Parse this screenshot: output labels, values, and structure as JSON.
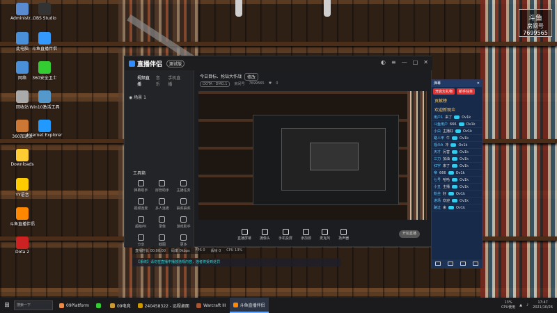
{
  "desktop": {
    "icons": [
      {
        "label": "Administr...",
        "color": "#5a8ad0"
      },
      {
        "label": "OBS Studio",
        "color": "#333"
      },
      {
        "label": "此电脑",
        "color": "#4a90d9"
      },
      {
        "label": "斗鱼直播伴侣",
        "color": "#39f"
      },
      {
        "label": "网络",
        "color": "#4a90d9"
      },
      {
        "label": "360安全卫士",
        "color": "#3c3"
      },
      {
        "label": "回收站",
        "color": "#aaa"
      },
      {
        "label": "Win10激活工具",
        "color": "#59c"
      },
      {
        "label": "360加速球",
        "color": "#c73"
      },
      {
        "label": "Internet Explorer",
        "color": "#29f"
      },
      {
        "label": "Downloads",
        "color": "#fc3"
      },
      {
        "label": "YY语音",
        "color": "#fc0"
      },
      {
        "label": "斗鱼直播伴侣",
        "color": "#f80"
      },
      {
        "label": "Dota 2",
        "color": "#c22"
      }
    ],
    "badge": {
      "brand": "斗鱼",
      "room_label": "房间号",
      "room": "7699565"
    }
  },
  "app": {
    "name": "直播伴侣",
    "tag": "测试版",
    "tabs": [
      "视频直播",
      "音乐",
      "手机直播"
    ],
    "scene": "场景 1",
    "header_title": "今日目标、抢钻大作战",
    "header_button": "修改",
    "game_tag": "DOTA · DMG.1",
    "room_label": "房间号",
    "room_no": "7699565",
    "fans": "0",
    "tools_title": "工具箱",
    "tools": [
      "弹幕助手",
      "房管助手",
      "主播任务",
      "视频连麦",
      "多人连麦",
      "抽奖抽奖",
      "超级PK",
      "录像",
      "游戏助手",
      "分享",
      "截图",
      "更多"
    ],
    "bottom": [
      "直播屏幕",
      "摄像头",
      "手机投屏",
      "添加源",
      "麦克风",
      "扬声器"
    ],
    "start_label": "开始直播",
    "status": [
      "直播时长 00:00:00",
      "码率 0kbps",
      "FPS 0",
      "丢帧 0",
      "CPU 13%"
    ],
    "notice": "【系统】请勿在直播中播放违规内容，违者将受到处罚"
  },
  "chat": {
    "title": "弹幕",
    "red_buttons": [
      "开启大礼物",
      "新手任务"
    ],
    "sections": [
      "贡献榜",
      "欢迎新观众"
    ],
    "rows": [
      {
        "user": "用户1",
        "msg": "来了",
        "gift": "Ov1k"
      },
      {
        "user": "斗鱼用户",
        "msg": "666",
        "gift": "Ov1k"
      },
      {
        "user": "小白",
        "msg": "主播好",
        "gift": "Ov1k"
      },
      {
        "user": "路人甲",
        "msg": "牛",
        "gift": "Ov1k"
      },
      {
        "user": "观众A",
        "msg": "冲",
        "gift": "Ov1k"
      },
      {
        "user": "天才",
        "msg": "厉害",
        "gift": "Ov1k"
      },
      {
        "user": "三刀",
        "msg": "加油",
        "gift": "Ov1k"
      },
      {
        "user": "红字",
        "msg": "来了",
        "gift": "Ov1k"
      },
      {
        "user": "帝",
        "msg": "666",
        "gift": "Ov1k"
      },
      {
        "user": "七号",
        "msg": "哈哈",
        "gift": "Ov1k"
      },
      {
        "user": "小丑",
        "msg": "主播",
        "gift": "Ov1k"
      },
      {
        "user": "粉丝",
        "msg": "好",
        "gift": "Ov1k"
      },
      {
        "user": "进场",
        "msg": "欢迎",
        "gift": "Ov1k"
      },
      {
        "user": "路过",
        "msg": "来",
        "gift": "Ov1k"
      }
    ]
  },
  "taskbar": {
    "search": "搜索一下",
    "apps": [
      {
        "label": "09Platform",
        "color": "#e84",
        "active": false
      },
      {
        "label": "",
        "color": "#3c3",
        "active": false
      },
      {
        "label": "09电竞",
        "color": "#c93",
        "active": false
      },
      {
        "label": "240458322 - 远程桌面",
        "color": "#c90",
        "active": false
      },
      {
        "label": "Warcraft III",
        "color": "#a53",
        "active": false
      },
      {
        "label": "斗鱼直播伴侣",
        "color": "#f80",
        "active": true
      }
    ],
    "cpu": "13%",
    "cpu_label": "CPU使用",
    "time": "17:47",
    "date": "2021/10/26"
  }
}
